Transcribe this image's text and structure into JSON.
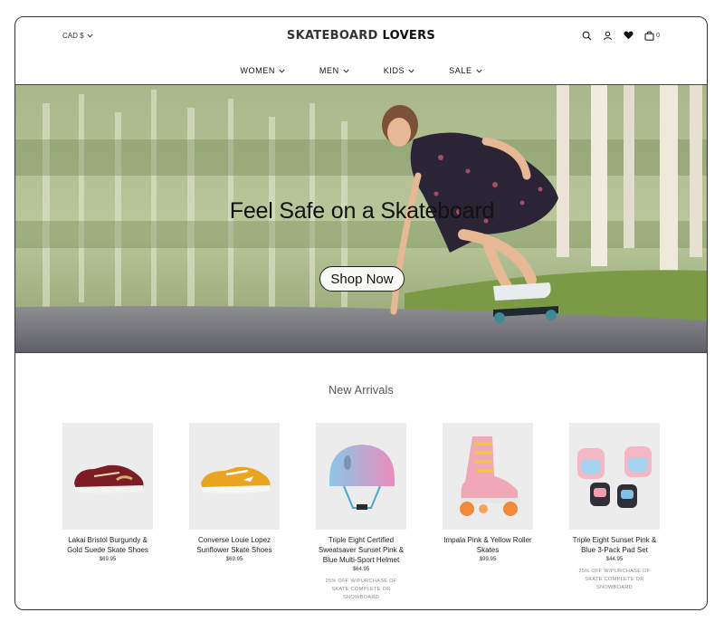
{
  "header": {
    "currency": "CAD $",
    "logo_part1": "SKATEBOARD",
    "logo_part2": "LOVERS",
    "cart_count": "0"
  },
  "nav": [
    {
      "label": "WOMEN"
    },
    {
      "label": "MEN"
    },
    {
      "label": "KIDS"
    },
    {
      "label": "SALE"
    }
  ],
  "hero": {
    "title": "Feel Safe on a Skateboard",
    "button": "Shop Now"
  },
  "arrivals": {
    "title": "New Arrivals",
    "products": [
      {
        "name": "Lakai Bristol Burgundy & Gold Suede Skate Shoes",
        "price": "$69.95",
        "promo": ""
      },
      {
        "name": "Converse Louie Lopez Sunflower Skate Shoes",
        "price": "$69.95",
        "promo": ""
      },
      {
        "name": "Triple Eight Certified Sweatsaver Sunset Pink & Blue Multi-Sport Helmet",
        "price": "$64.95",
        "promo": "25% OFF W/PURCHASE OF SKATE COMPLETE OR SNOWBOARD"
      },
      {
        "name": "Impala Pink & Yellow Roller Skates",
        "price": "$99.95",
        "promo": ""
      },
      {
        "name": "Triple Eight Sunset Pink & Blue 3-Pack Pad Set",
        "price": "$44.95",
        "promo": "25% OFF W/PURCHASE OF SKATE COMPLETE OR SNOWBOARD"
      }
    ]
  },
  "icons": {
    "currency": "chevron-down-icon",
    "search": "search-icon",
    "account": "user-icon",
    "wishlist": "heart-icon",
    "cart": "cart-icon"
  }
}
